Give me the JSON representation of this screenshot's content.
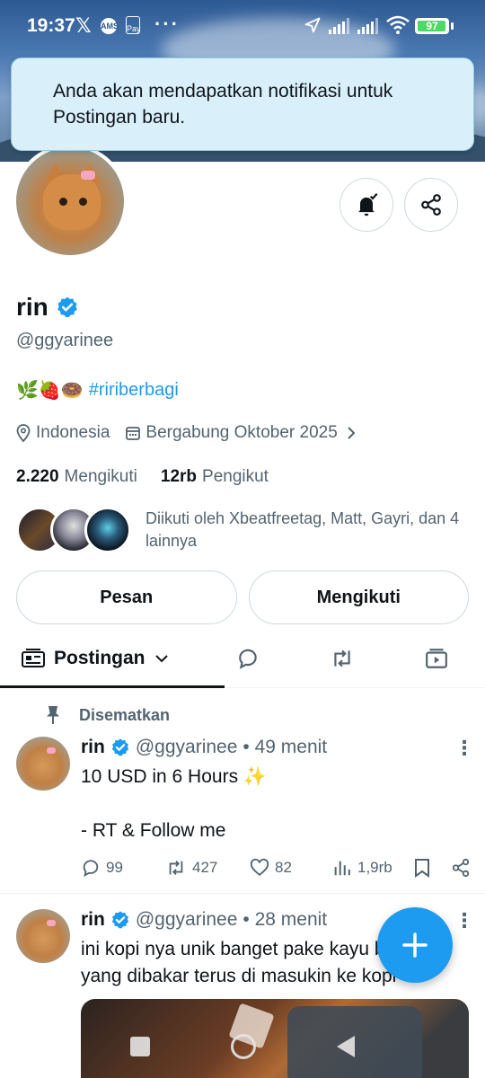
{
  "status_bar": {
    "time": "19:37",
    "x_label": "𝕏",
    "ams_label": "AMS",
    "pay_label": "Pay",
    "dots": "···",
    "battery": "97",
    "battery_fraction": 0.97
  },
  "toast": {
    "message": "Anda akan mendapatkan notifikasi untuk Postingan baru."
  },
  "profile": {
    "name": "rin",
    "handle": "@ggyarinee",
    "bio_emoji": "🌿🍓🍩",
    "bio_hashtag": "#ririberbagi",
    "location": "Indonesia",
    "joined": "Bergabung Oktober 2025",
    "following_count": "2.220",
    "following_label": "Mengikuti",
    "followers_count": "12rb",
    "followers_label": "Pengikut",
    "followed_by": "Diikuti oleh Xbeatfreetag, Matt, Gayri, dan 4 lainnya"
  },
  "buttons": {
    "message": "Pesan",
    "following": "Mengikuti"
  },
  "tabs": {
    "active": "Postingan"
  },
  "posts": [
    {
      "pinned_label": "Disematkan",
      "name": "rin",
      "handle": "@ggyarinee",
      "time": "• 49 menit",
      "line1": "10 USD in 6 Hours ✨",
      "line2": "- RT & Follow me",
      "replies": "99",
      "reposts": "427",
      "likes": "82",
      "views": "1,9rb"
    },
    {
      "name": "rin",
      "handle": "@ggyarinee",
      "time": "• 28 menit",
      "line1": "ini kopi nya unik banget pake kayu bus",
      "line2": "yang dibakar terus di masukin ke kopi"
    }
  ],
  "colors": {
    "accent": "#1d9bf0",
    "text": "#0f1419",
    "muted": "#536471",
    "toast_bg": "#d9f0fb"
  }
}
